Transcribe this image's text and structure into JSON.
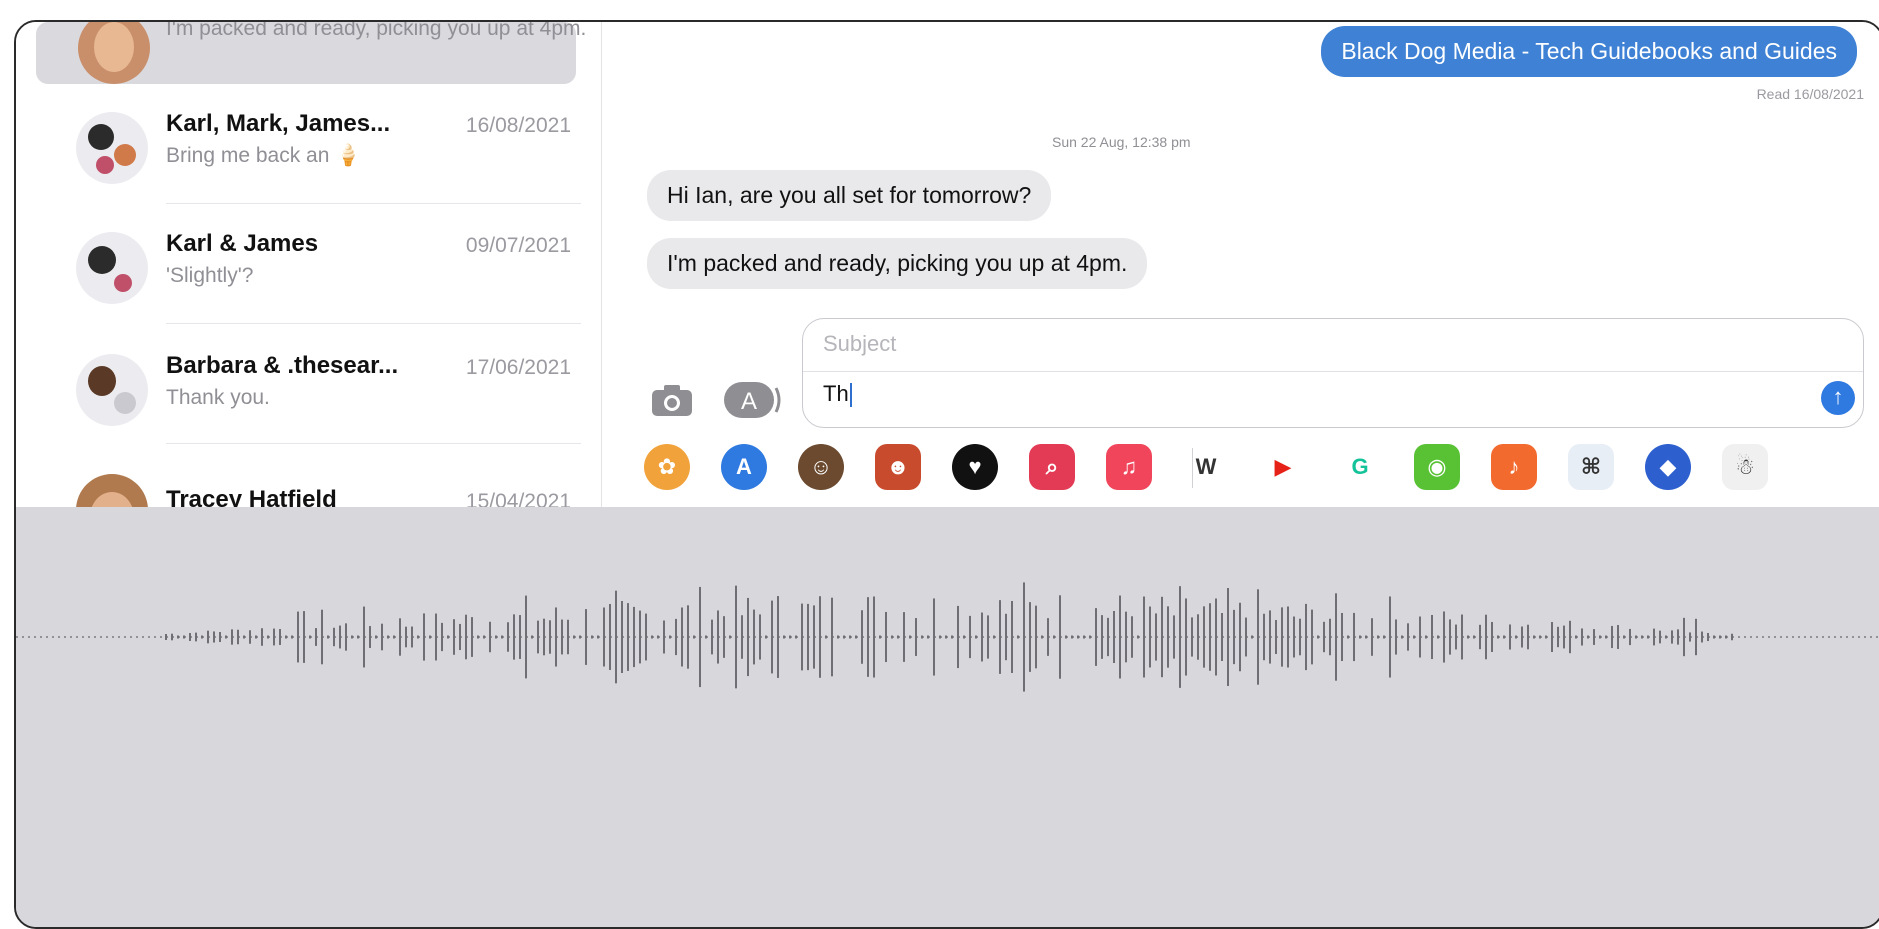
{
  "sidebar": {
    "selected": {
      "preview": "I'm packed and ready, picking you up at 4pm."
    },
    "conversations": [
      {
        "name": "Karl, Mark, James...",
        "date": "16/08/2021",
        "preview": "Bring me back an 🍦"
      },
      {
        "name": "Karl & James",
        "date": "09/07/2021",
        "preview": "'Slightly'?"
      },
      {
        "name": "Barbara & .thesear...",
        "date": "17/06/2021",
        "preview": "Thank you."
      },
      {
        "name": "Tracey Hatfield",
        "date": "15/04/2021",
        "preview": ""
      }
    ]
  },
  "chat": {
    "outgoing": "Black Dog Media - Tech Guidebooks and Guides",
    "read_receipt": "Read 16/08/2021",
    "timestamp": "Sun 22 Aug, 12:38 pm",
    "incoming": [
      "Hi Ian, are you all set for tomorrow?",
      "I'm packed and ready, picking you up at 4pm."
    ],
    "compose": {
      "subject_placeholder": "Subject",
      "text": "Th"
    },
    "icons": {
      "camera": "camera-icon",
      "appstore": "app-store-icon",
      "send": "send-arrow-icon"
    },
    "apps": [
      {
        "name": "photos-icon",
        "glyph": "✿",
        "color": "#f2a23b"
      },
      {
        "name": "app-store-icon",
        "glyph": "A",
        "color": "#2f7ae0"
      },
      {
        "name": "memoji-icon",
        "glyph": "☺",
        "color": "#6b4a2f"
      },
      {
        "name": "animoji-icon",
        "glyph": "☻",
        "color": "#c94b2d"
      },
      {
        "name": "digital-touch-icon",
        "glyph": "♥",
        "color": "#111111"
      },
      {
        "name": "search-images-icon",
        "glyph": "⌕",
        "color": "#e33b55"
      },
      {
        "name": "music-icon",
        "glyph": "♫",
        "color": "#f0455a"
      },
      {
        "name": "wikipedia-icon",
        "glyph": "W",
        "color": "#ffffff"
      },
      {
        "name": "youtube-icon",
        "glyph": "▶",
        "color": "#ffffff"
      },
      {
        "name": "grammarly-icon",
        "glyph": "G",
        "color": "#ffffff"
      },
      {
        "name": "duolingo-icon",
        "glyph": "◉",
        "color": "#58c234"
      },
      {
        "name": "garageband-icon",
        "glyph": "♪",
        "color": "#f26a2e"
      },
      {
        "name": "bat-icon",
        "glyph": "⌘",
        "color": "#e8eef5"
      },
      {
        "name": "dropbox-icon",
        "glyph": "◆",
        "color": "#2d5fcf"
      },
      {
        "name": "panda-icon",
        "glyph": "☃",
        "color": "#f0f0f0"
      }
    ]
  },
  "dictation": {
    "waveform": "dictation-waveform"
  }
}
